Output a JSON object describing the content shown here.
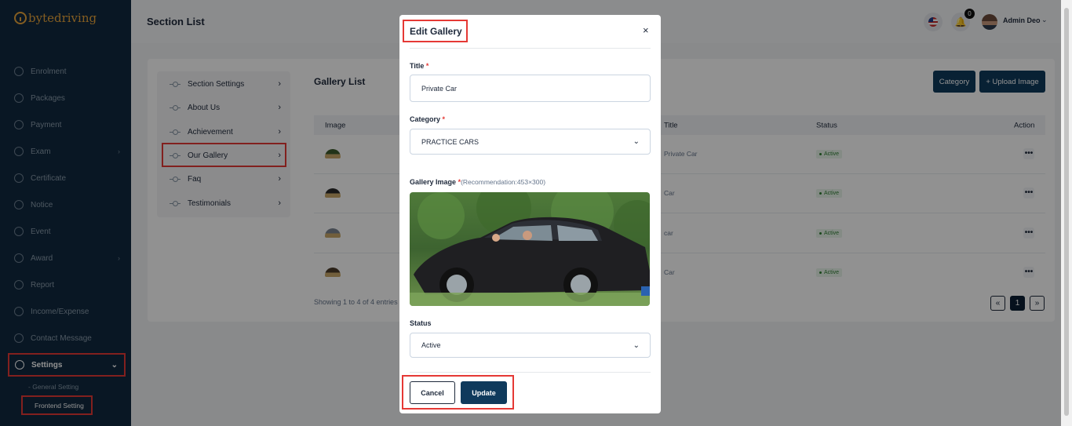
{
  "brand": {
    "name_bold": "byte",
    "name_light": "driving"
  },
  "sidebar": {
    "items": [
      {
        "label": "Enrolment",
        "icon": "enrolment-icon",
        "has_chevron": false
      },
      {
        "label": "Packages",
        "icon": "packages-icon",
        "has_chevron": false
      },
      {
        "label": "Payment",
        "icon": "payment-icon",
        "has_chevron": false
      },
      {
        "label": "Exam",
        "icon": "exam-icon",
        "has_chevron": true
      },
      {
        "label": "Certificate",
        "icon": "certificate-icon",
        "has_chevron": false
      },
      {
        "label": "Notice",
        "icon": "notice-icon",
        "has_chevron": false
      },
      {
        "label": "Event",
        "icon": "event-icon",
        "has_chevron": false
      },
      {
        "label": "Award",
        "icon": "award-icon",
        "has_chevron": true
      },
      {
        "label": "Report",
        "icon": "report-icon",
        "has_chevron": false
      },
      {
        "label": "Income/Expense",
        "icon": "income-expense-icon",
        "has_chevron": false
      },
      {
        "label": "Contact Message",
        "icon": "contact-message-icon",
        "has_chevron": false
      }
    ],
    "settings": {
      "label": "Settings",
      "icon": "gear-icon",
      "expanded": true
    },
    "sub_items": [
      {
        "label": "General Setting",
        "prefix": "-"
      },
      {
        "label": "Frontend Setting",
        "active": true
      }
    ]
  },
  "topbar": {
    "title": "Section List",
    "notification_count": "0",
    "user_name": "Admin Deo"
  },
  "section_menu": {
    "items": [
      {
        "label": "Section Settings"
      },
      {
        "label": "About Us"
      },
      {
        "label": "Achievement"
      },
      {
        "label": "Our Gallery",
        "active": true
      },
      {
        "label": "Faq"
      },
      {
        "label": "Testimonials"
      }
    ]
  },
  "gallery_list": {
    "title": "Gallery List",
    "category_button": "Category",
    "upload_button": "+ Upload Image",
    "columns": {
      "image": "Image",
      "title": "Title",
      "status": "Status",
      "action": "Action"
    },
    "rows": [
      {
        "title": "Private Car",
        "status": "Active",
        "action": "•••"
      },
      {
        "title": "Car",
        "status": "Active",
        "action": "•••"
      },
      {
        "title": "car",
        "status": "Active",
        "action": "•••"
      },
      {
        "title": "Car",
        "status": "Active",
        "action": "•••"
      }
    ],
    "showing": "Showing 1 to 4 of 4 entries",
    "pagination": {
      "prev": "«",
      "current": "1",
      "next": "»"
    }
  },
  "modal": {
    "title": "Edit Gallery",
    "close": "×",
    "title_label": "Title",
    "title_value": "Private Car",
    "category_label": "Category",
    "category_value": "PRACTICE CARS",
    "image_label": "Gallery Image",
    "image_hint": "(Recommendation:453×300)",
    "required_mark": "*",
    "status_label": "Status",
    "status_value": "Active",
    "cancel_button": "Cancel",
    "update_button": "Update"
  },
  "colors": {
    "sidebar_bg": "#102a40",
    "primary_button": "#0f3a5c",
    "highlight_border": "#e53935",
    "brand_accent": "#e8a43b",
    "status_active": "#2e7d32"
  }
}
